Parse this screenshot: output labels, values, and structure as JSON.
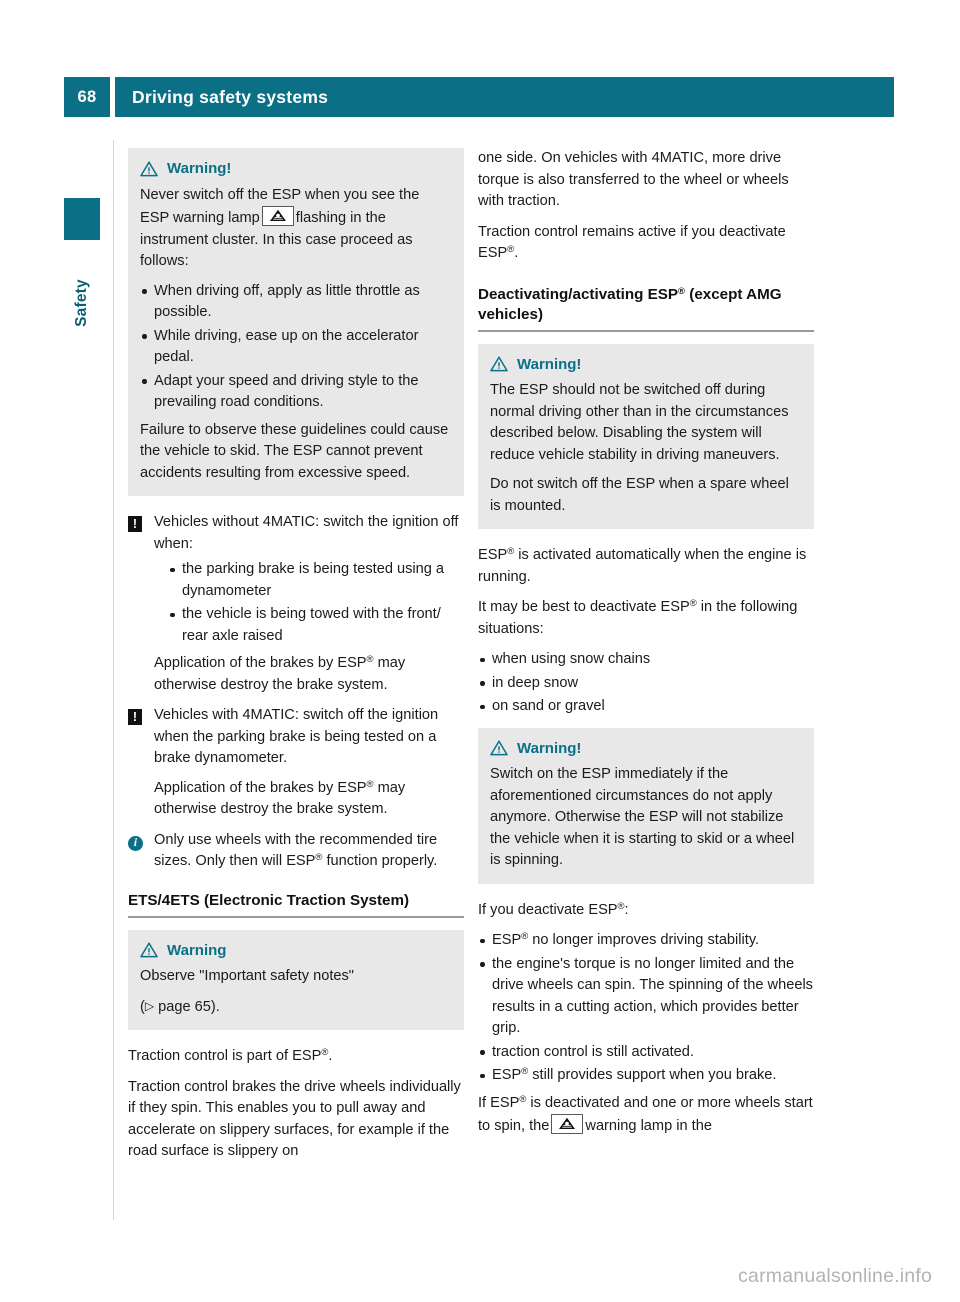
{
  "header": {
    "page_number": "68",
    "title": "Driving safety systems",
    "accent_color": "#0b7086"
  },
  "side_tab": {
    "label": "Safety"
  },
  "left_column": {
    "warning_box_1": {
      "title": "Warning!",
      "icon": "warning-triangle-icon",
      "intro_before_lamp": "Never switch off the ESP when you see the ESP warning lamp",
      "lamp_icon": "esp-warning-lamp-icon",
      "intro_after_lamp": "flashing in the instrument cluster. In this case proceed as follows:",
      "bullets": [
        "When driving off, apply as little throttle as possible.",
        "While driving, ease up on the accelerator pedal.",
        "Adapt your speed and driving style to the prevailing road conditions."
      ],
      "closing": "Failure to observe these guidelines could cause the vehicle to skid. The ESP cannot prevent accidents resulting from excessive speed."
    },
    "note_without_4matic": {
      "icon": "exclamation-box-icon",
      "lead": "Vehicles without 4MATIC: switch the ignition off when:",
      "bullets": [
        "the parking brake is being tested using a dynamometer",
        "the vehicle is being towed with the front/ rear axle raised"
      ],
      "closing_before_esp": "Application of the brakes by ESP",
      "closing_after_esp": " may otherwise destroy the brake system."
    },
    "note_with_4matic": {
      "icon": "exclamation-box-icon",
      "lead": "Vehicles with 4MATIC: switch off the ignition when the parking brake is being tested on a brake dynamometer.",
      "closing_before_esp": "Application of the brakes by ESP",
      "closing_after_esp": " may otherwise destroy the brake system."
    },
    "info_note": {
      "icon": "info-circle-icon",
      "text_before_esp": "Only use wheels with the recommended tire sizes. Only then will ESP",
      "text_after_esp": " function properly."
    },
    "section_heading": "ETS/4ETS (Electronic Traction System)",
    "warning_box_2": {
      "title": "Warning",
      "icon": "warning-triangle-icon",
      "line1": "Observe \"Important safety notes\"",
      "reference_open": "(",
      "reference_arrow": "▷",
      "reference_text": " page 65).",
      "reference_page": "65"
    },
    "paragraph_1_before_esp": "Traction control is part of ESP",
    "paragraph_1_after_esp": ".",
    "paragraph_2": "Traction control brakes the drive wheels individually if they spin. This enables you to pull away and accelerate on slippery surfaces, for example if the road surface is slippery on"
  },
  "right_column": {
    "paragraph_1": "one side. On vehicles with 4MATIC, more drive torque is also transferred to the wheel or wheels with traction.",
    "paragraph_2_before_esp": "Traction control remains active if you deactivate ESP",
    "paragraph_2_after_esp": ".",
    "section_heading_before_esp": "Deactivating/activating ESP",
    "section_heading_after_esp": " (except AMG vehicles)",
    "warning_box_1": {
      "title": "Warning!",
      "icon": "warning-triangle-icon",
      "paragraph_1": "The ESP should not be switched off during normal driving other than in the circumstances described below. Disabling the system will reduce vehicle stability in driving maneuvers.",
      "paragraph_2": "Do not switch off the ESP when a spare wheel is mounted."
    },
    "paragraph_3_before_esp": "ESP",
    "paragraph_3_after_esp": " is activated automatically when the engine is running.",
    "paragraph_4_before_esp": "It may be best to deactivate ESP",
    "paragraph_4_after_esp": " in the following situations:",
    "situations": [
      "when using snow chains",
      "in deep snow",
      "on sand or gravel"
    ],
    "warning_box_2": {
      "title": "Warning!",
      "icon": "warning-triangle-icon",
      "paragraph_1": "Switch on the ESP immediately if the aforementioned circumstances do not apply anymore. Otherwise the ESP will not stabilize the vehicle when it is starting to skid or a wheel is spinning."
    },
    "deactivate_lead_before_esp": "If you deactivate ESP",
    "deactivate_lead_after_esp": ":",
    "deactivate_bullets": [
      {
        "before_esp": "ESP",
        "after_esp": " no longer improves driving stability."
      },
      {
        "before_esp": "",
        "after_esp": "the engine's torque is no longer limited and the drive wheels can spin. The spinning of the wheels results in a cutting action, which provides better grip."
      },
      {
        "before_esp": "",
        "after_esp": "traction control is still activated."
      },
      {
        "before_esp": "ESP",
        "after_esp": " still provides support when you brake."
      }
    ],
    "closing_before_esp": "If ESP",
    "closing_mid": " is deactivated and one or more wheels start to spin, the",
    "lamp_icon": "esp-warning-lamp-icon",
    "closing_after_lamp": "warning lamp in the"
  },
  "watermark": {
    "text": "carmanualsonline.info"
  }
}
